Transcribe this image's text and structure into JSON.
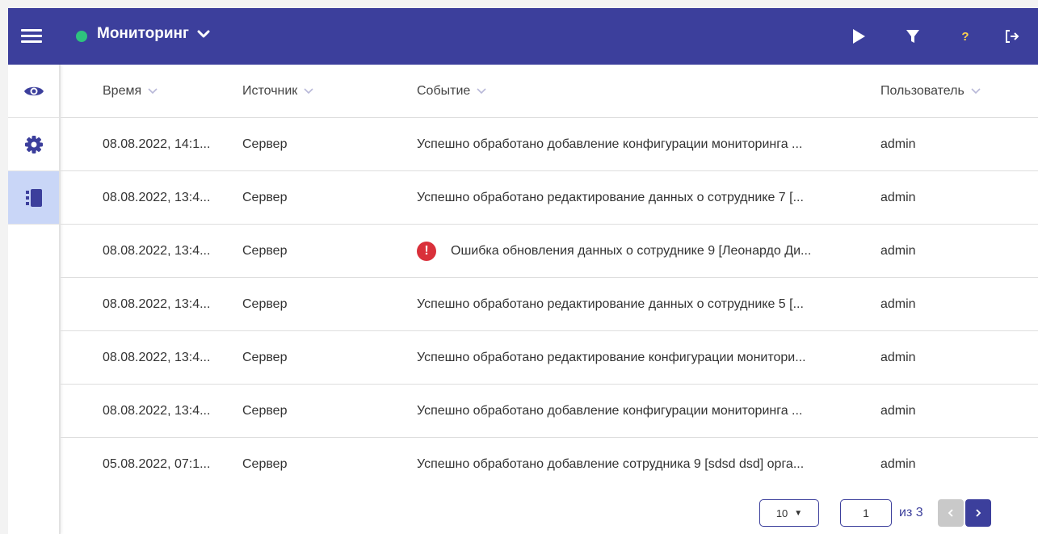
{
  "header": {
    "title": "Мониторинг",
    "status_color": "#2ec27e",
    "help_label": "?",
    "icons": [
      "menu-icon",
      "chevron-down-icon",
      "play-icon",
      "filter-icon",
      "help-icon",
      "logout-icon"
    ]
  },
  "sidebar": {
    "items": [
      {
        "icon": "eye-icon",
        "active": false
      },
      {
        "icon": "gear-icon",
        "active": false
      },
      {
        "icon": "journal-icon",
        "active": true
      }
    ]
  },
  "table": {
    "columns": [
      "Время",
      "Источник",
      "Событие",
      "Пользователь"
    ],
    "rows": [
      {
        "time": "08.08.2022, 14:1...",
        "source": "Сервер",
        "event": "Успешно обработано добавление конфигурации мониторинга ...",
        "user": "admin",
        "error": false
      },
      {
        "time": "08.08.2022, 13:4...",
        "source": "Сервер",
        "event": "Успешно обработано редактирование данных о сотруднике 7 [...",
        "user": "admin",
        "error": false
      },
      {
        "time": "08.08.2022, 13:4...",
        "source": "Сервер",
        "event": "Ошибка обновления данных о сотруднике 9 [Леонардо Ди...",
        "user": "admin",
        "error": true
      },
      {
        "time": "08.08.2022, 13:4...",
        "source": "Сервер",
        "event": "Успешно обработано редактирование данных о сотруднике 5 [...",
        "user": "admin",
        "error": false
      },
      {
        "time": "08.08.2022, 13:4...",
        "source": "Сервер",
        "event": "Успешно обработано редактирование конфигурации монитори...",
        "user": "admin",
        "error": false
      },
      {
        "time": "08.08.2022, 13:4...",
        "source": "Сервер",
        "event": "Успешно обработано добавление конфигурации мониторинга ...",
        "user": "admin",
        "error": false
      },
      {
        "time": "05.08.2022, 07:1...",
        "source": "Сервер",
        "event": "Успешно обработано добавление сотрудника 9 [sdsd dsd] орга...",
        "user": "admin",
        "error": false
      }
    ]
  },
  "pagination": {
    "page_size": "10",
    "current_page": "1",
    "of_label": "из 3"
  },
  "colors": {
    "accent": "#3c3f9c",
    "error": "#d9303a",
    "active_nav": "#c9d6f7"
  }
}
